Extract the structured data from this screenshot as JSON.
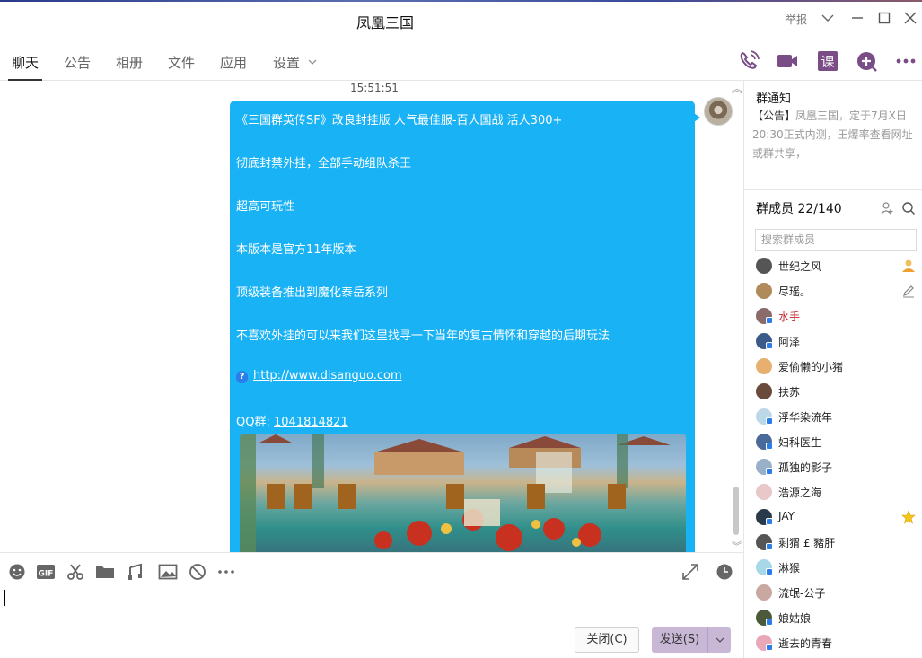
{
  "window": {
    "title": "凤凰三国",
    "report_label": "举报"
  },
  "tabs": [
    {
      "label": "聊天",
      "active": true
    },
    {
      "label": "公告"
    },
    {
      "label": "相册"
    },
    {
      "label": "文件"
    },
    {
      "label": "应用"
    },
    {
      "label": "设置"
    }
  ],
  "header_actions": [
    "phone-icon",
    "video-icon",
    "course-icon",
    "add-app-icon",
    "more-icon"
  ],
  "chat": {
    "timestamp": "15:51:51",
    "message": {
      "lines": [
        "《三国群英传SF》改良封挂版 人气最佳服-百人国战 活人300+",
        "彻底封禁外挂，全部手动组队杀王",
        "超高可玩性",
        "本版本是官方11年版本",
        "顶级装备推出到魔化泰岳系列",
        "不喜欢外挂的可以来我们这里找寻一下当年的复古情怀和穿越的后期玩法"
      ],
      "link_url": "http://www.disanguo.com",
      "qq_label": "QQ群:",
      "qq_number": "1041814821"
    }
  },
  "input_toolbar": [
    "emoji-icon",
    "gif-icon",
    "scissors-icon",
    "folder-icon",
    "music-icon",
    "image-icon",
    "block-icon",
    "more-icon",
    "expand-icon",
    "history-icon"
  ],
  "input": {
    "value": ""
  },
  "buttons": {
    "close": "关闭(C)",
    "send": "发送(S)"
  },
  "sidebar": {
    "notice_title": "群通知",
    "notice_tag": "【公告】",
    "notice_text": "凤凰三国，定于7月X日20:30正式内测，王爆率查看网址或群共享，",
    "members_title": "群成员 22/140",
    "search_placeholder": "搜索群成员",
    "members": [
      {
        "name": "世纪之风",
        "icon": "owner-icon",
        "avatar_color": "#555"
      },
      {
        "name": "尽瑶。",
        "icon": "edit-icon",
        "avatar_color": "#b08a5a"
      },
      {
        "name": "水手",
        "red": true,
        "avatar_color": "#8a6a6a"
      },
      {
        "name": "阿泽",
        "avatar_color": "#3a5a8a"
      },
      {
        "name": "爱偷懒的小猪",
        "avatar_color": "#e8b070"
      },
      {
        "name": "扶苏",
        "avatar_color": "#6a4a3a"
      },
      {
        "name": "浮华染流年",
        "avatar_color": "#bcd8e8"
      },
      {
        "name": "妇科医生",
        "avatar_color": "#4a6a9a"
      },
      {
        "name": "孤独的影子",
        "avatar_color": "#9ab0c8"
      },
      {
        "name": "浩源之海",
        "avatar_color": "#e8c8c8"
      },
      {
        "name": "JAY",
        "icon": "star-icon",
        "avatar_color": "#2a3a4a"
      },
      {
        "name": "剩猬 £ 豬肝",
        "avatar_color": "#555"
      },
      {
        "name": "淋猴",
        "avatar_color": "#a8d8e8"
      },
      {
        "name": "流氓-公子",
        "avatar_color": "#c8a8a0"
      },
      {
        "name": "娘姑娘",
        "avatar_color": "#4a5a3a"
      },
      {
        "name": "逝去的青春",
        "avatar_color": "#e8a8b8"
      }
    ]
  }
}
